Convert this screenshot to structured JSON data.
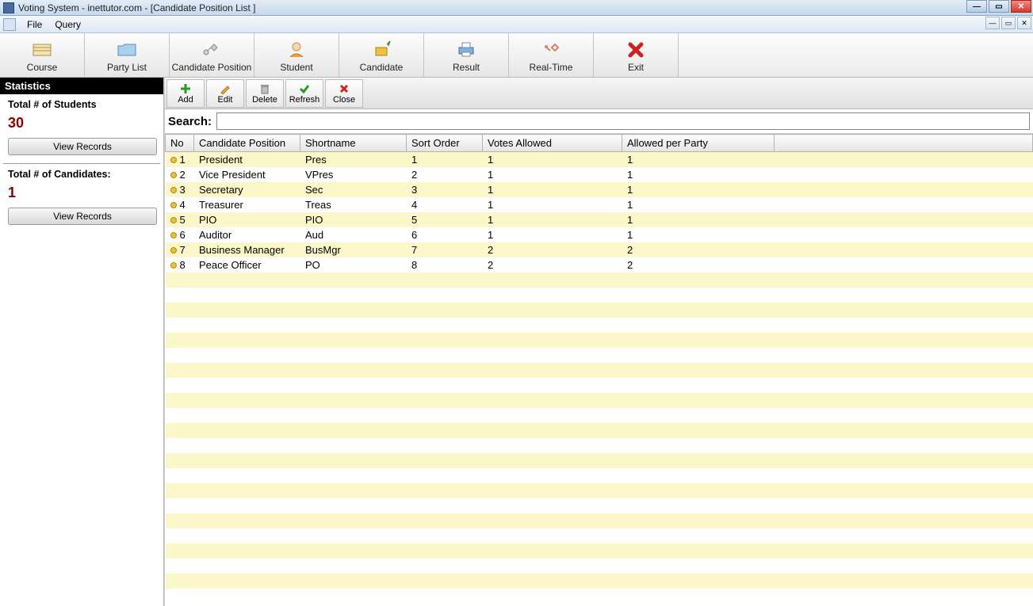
{
  "window": {
    "title": "Voting System - inettutor.com - [Candidate Position List ]"
  },
  "menus": {
    "file": "File",
    "query": "Query"
  },
  "toolbar": [
    {
      "key": "course",
      "label": "Course"
    },
    {
      "key": "party-list",
      "label": "Party List"
    },
    {
      "key": "candidate-position",
      "label": "Candidate Position"
    },
    {
      "key": "student",
      "label": "Student"
    },
    {
      "key": "candidate",
      "label": "Candidate"
    },
    {
      "key": "result",
      "label": "Result"
    },
    {
      "key": "real-time",
      "label": "Real-Time"
    },
    {
      "key": "exit",
      "label": "Exit"
    }
  ],
  "sidebar": {
    "header": "Statistics",
    "students_label": "Total # of Students",
    "students_value": "30",
    "students_btn": "View Records",
    "candidates_label": "Total # of Candidates:",
    "candidates_value": "1",
    "candidates_btn": "View Records"
  },
  "actions": {
    "add": "Add",
    "edit": "Edit",
    "delete": "Delete",
    "refresh": "Refresh",
    "close": "Close"
  },
  "search": {
    "label": "Search:",
    "value": ""
  },
  "columns": {
    "no": "No",
    "position": "Candidate Position",
    "shortname": "Shortname",
    "sort": "Sort Order",
    "votes": "Votes Allowed",
    "allowed": "Allowed per Party"
  },
  "rows": [
    {
      "no": "1",
      "position": "President",
      "short": "Pres",
      "sort": "1",
      "votes": "1",
      "allowed": "1"
    },
    {
      "no": "2",
      "position": "Vice President",
      "short": "VPres",
      "sort": "2",
      "votes": "1",
      "allowed": "1"
    },
    {
      "no": "3",
      "position": "Secretary",
      "short": "Sec",
      "sort": "3",
      "votes": "1",
      "allowed": "1"
    },
    {
      "no": "4",
      "position": "Treasurer",
      "short": "Treas",
      "sort": "4",
      "votes": "1",
      "allowed": "1"
    },
    {
      "no": "5",
      "position": "PIO",
      "short": "PIO",
      "sort": "5",
      "votes": "1",
      "allowed": "1"
    },
    {
      "no": "6",
      "position": "Auditor",
      "short": "Aud",
      "sort": "6",
      "votes": "1",
      "allowed": "1"
    },
    {
      "no": "7",
      "position": "Business Manager",
      "short": "BusMgr",
      "sort": "7",
      "votes": "2",
      "allowed": "2"
    },
    {
      "no": "8",
      "position": "Peace Officer",
      "short": "PO",
      "sort": "8",
      "votes": "2",
      "allowed": "2"
    }
  ],
  "empty_row_count": 21
}
